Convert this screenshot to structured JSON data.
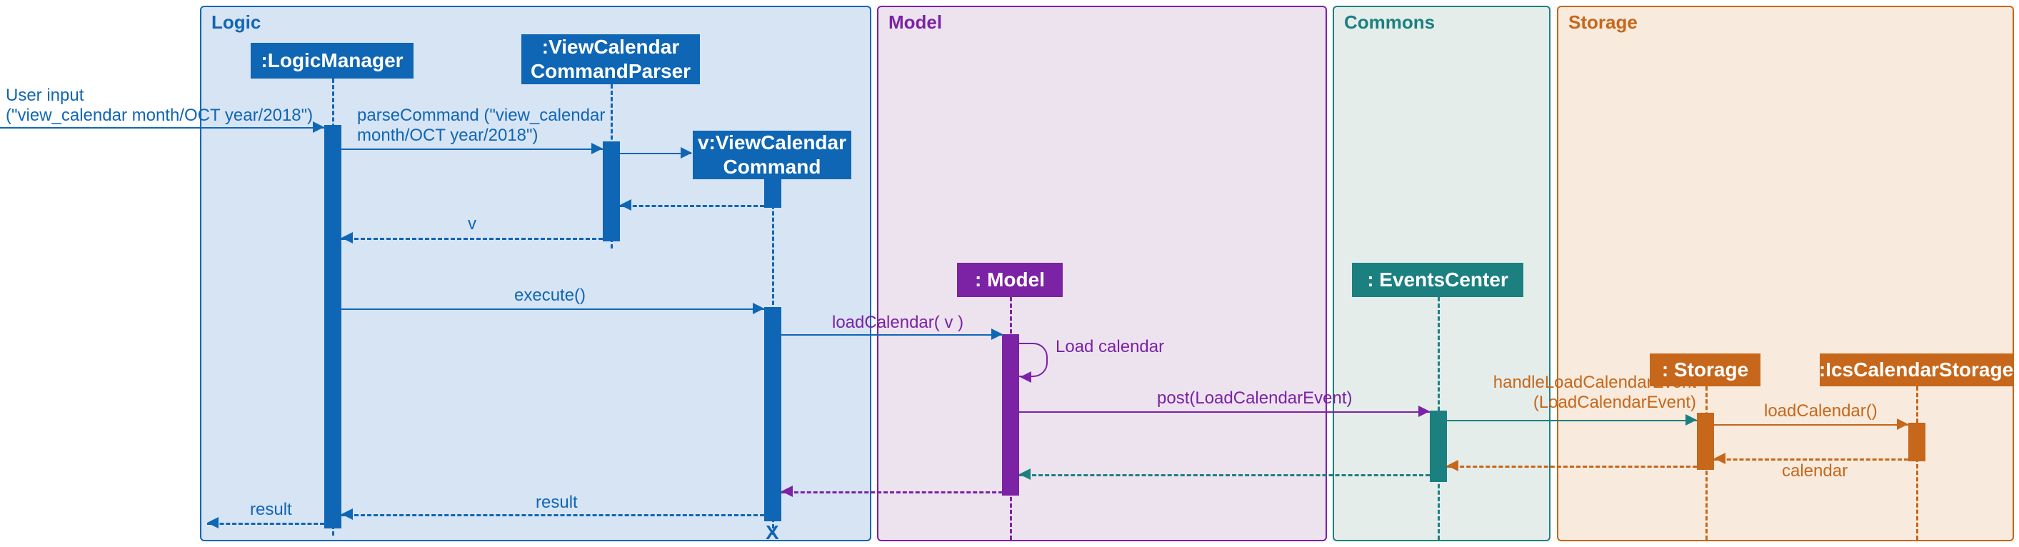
{
  "chart_data": {
    "type": "sequence_diagram",
    "containers": [
      {
        "name": "Logic",
        "color": "#0f66b5",
        "fill": "#d7e4f4"
      },
      {
        "name": "Model",
        "color": "#7c22a5",
        "fill": "#ece3ef"
      },
      {
        "name": "Commons",
        "color": "#1c8081",
        "fill": "#e5edea"
      },
      {
        "name": "Storage",
        "color": "#c6671b",
        "fill": "#f8eadc"
      }
    ],
    "lifelines": [
      {
        "name": ":LogicManager",
        "container": "Logic"
      },
      {
        "name": ":ViewCalendar\nCommandParser",
        "container": "Logic"
      },
      {
        "name": "v:ViewCalendar\nCommand",
        "container": "Logic",
        "created": true,
        "destroyed": true
      },
      {
        "name": ": Model",
        "container": "Model"
      },
      {
        "name": ": EventsCenter",
        "container": "Commons"
      },
      {
        "name": ": Storage",
        "container": "Storage"
      },
      {
        "name": ":IcsCalendarStorage",
        "container": "Storage"
      }
    ],
    "messages": [
      {
        "from": "User",
        "to": ":LogicManager",
        "label": "User input\n(\"view_calendar month/OCT year/2018\")",
        "type": "call"
      },
      {
        "from": ":LogicManager",
        "to": ":ViewCalendar CommandParser",
        "label": "parseCommand (\"view_calendar month/OCT year/2018\")",
        "type": "call"
      },
      {
        "from": ":ViewCalendar CommandParser",
        "to": "v:ViewCalendar Command",
        "label": "",
        "type": "create"
      },
      {
        "from": "v:ViewCalendar Command",
        "to": ":ViewCalendar CommandParser",
        "label": "",
        "type": "return"
      },
      {
        "from": ":ViewCalendar CommandParser",
        "to": ":LogicManager",
        "label": "v",
        "type": "return"
      },
      {
        "from": ":LogicManager",
        "to": "v:ViewCalendar Command",
        "label": "execute()",
        "type": "call"
      },
      {
        "from": "v:ViewCalendar Command",
        "to": ": Model",
        "label": "loadCalendar( v )",
        "type": "call"
      },
      {
        "from": ": Model",
        "to": ": Model",
        "label": "Load calendar",
        "type": "self"
      },
      {
        "from": ": Model",
        "to": ": EventsCenter",
        "label": "post(LoadCalendarEvent)",
        "type": "call"
      },
      {
        "from": ": EventsCenter",
        "to": ": Storage",
        "label": "handleLoadCalendarEvent (LoadCalendarEvent)",
        "type": "call"
      },
      {
        "from": ": Storage",
        "to": ":IcsCalendarStorage",
        "label": "loadCalendar()",
        "type": "call"
      },
      {
        "from": ":IcsCalendarStorage",
        "to": ": Storage",
        "label": "calendar",
        "type": "return"
      },
      {
        "from": ": Storage",
        "to": ": EventsCenter",
        "label": "",
        "type": "return"
      },
      {
        "from": ": EventsCenter",
        "to": ": Model",
        "label": "",
        "type": "return"
      },
      {
        "from": ": Model",
        "to": "v:ViewCalendar Command",
        "label": "",
        "type": "return"
      },
      {
        "from": "v:ViewCalendar Command",
        "to": ":LogicManager",
        "label": "result",
        "type": "return"
      },
      {
        "from": ":LogicManager",
        "to": "User",
        "label": "result",
        "type": "return"
      }
    ]
  },
  "labels": {
    "logic": "Logic",
    "model": "Model",
    "commons": "Commons",
    "storage": "Storage",
    "logicManager": ":LogicManager",
    "viewCalParser": ":ViewCalendar\nCommandParser",
    "viewCalCmd": "v:ViewCalendar\nCommand",
    "modelHead": ": Model",
    "eventsCenter": ": EventsCenter",
    "storageHead": ": Storage",
    "icsStorage": ":IcsCalendarStorage",
    "userInput1": "User input",
    "userInput2": "(\"view_calendar month/OCT year/2018\")",
    "parseCmd1": "parseCommand (\"view_calendar",
    "parseCmd2": "month/OCT year/2018\")",
    "vReturn": "v",
    "execute": "execute()",
    "loadCalendarV": "loadCalendar( v )",
    "loadCalendarSelf": "Load calendar",
    "postEvent": "post(LoadCalendarEvent)",
    "handleEvent1": "handleLoadCalendarEvent",
    "handleEvent2": "(LoadCalendarEvent)",
    "loadCalendar": "loadCalendar()",
    "calendar": "calendar",
    "result": "result",
    "x": "X"
  },
  "colors": {
    "logic": "#0f66b5",
    "logicFill": "#d7e4f4",
    "model": "#7c22a5",
    "modelFill": "#ece3ef",
    "commons": "#1c8081",
    "commonsFill": "#e5edea",
    "storage": "#c6671b",
    "storageFill": "#f8eadc"
  }
}
